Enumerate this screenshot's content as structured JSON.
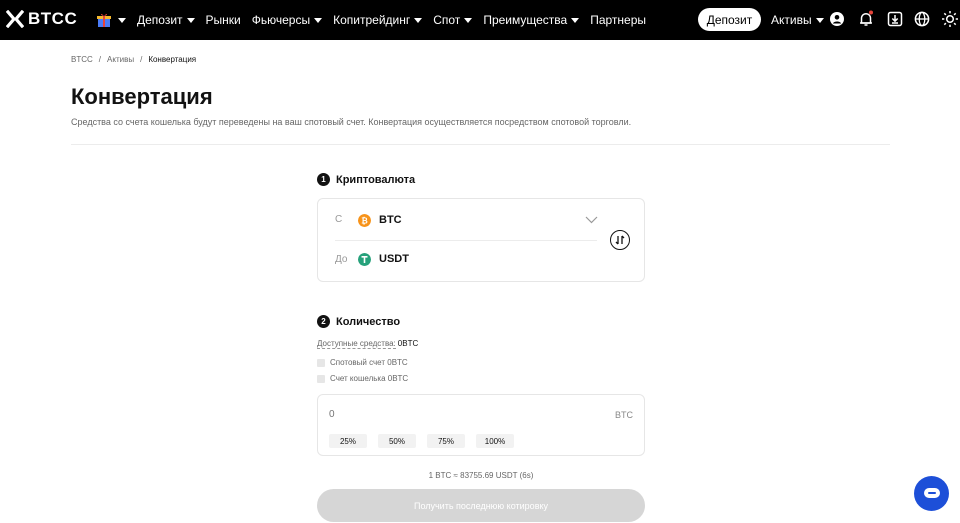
{
  "brand": {
    "name": "BTCC"
  },
  "nav": {
    "items": [
      {
        "label": "Депозит",
        "has_caret": true
      },
      {
        "label": "Рынки",
        "has_caret": false
      },
      {
        "label": "Фьючерсы",
        "has_caret": true
      },
      {
        "label": "Копитрейдинг",
        "has_caret": true
      },
      {
        "label": "Спот",
        "has_caret": true
      },
      {
        "label": "Преимущества",
        "has_caret": true
      },
      {
        "label": "Партнеры",
        "has_caret": false
      }
    ],
    "deposit_button": "Депозит",
    "assets": "Активы",
    "icons": [
      "gift-icon",
      "user-icon",
      "bell-icon",
      "download-icon",
      "globe-icon",
      "sun-icon"
    ]
  },
  "breadcrumb": [
    "BTCC",
    "Активы",
    "Конвертация"
  ],
  "page": {
    "title": "Конвертация",
    "description": "Средства со счета кошелька будут переведены на ваш спотовый счет. Конвертация осуществляется посредством спотовой торговли."
  },
  "step1": {
    "number": "1",
    "title": "Криптовалюта",
    "from_label": "С",
    "from_coin": "BTC",
    "to_label": "До",
    "to_coin": "USDT"
  },
  "step2": {
    "number": "2",
    "title": "Количество",
    "available_label": "Доступные средства:",
    "available_value": "0BTC",
    "spot_account": "Спотовый счет 0BTC",
    "wallet_account": "Счет кошелька 0BTC",
    "amount_placeholder": "0",
    "amount_unit": "BTC",
    "percent_buttons": [
      "25%",
      "50%",
      "75%",
      "100%"
    ]
  },
  "rate": "1 BTC ≈ 83755.69 USDT (6s)",
  "quote_button": "Получить последнюю котировку",
  "colors": {
    "btc": "#f7931a",
    "usdt": "#26a17b",
    "chat": "#1d4fd8"
  }
}
